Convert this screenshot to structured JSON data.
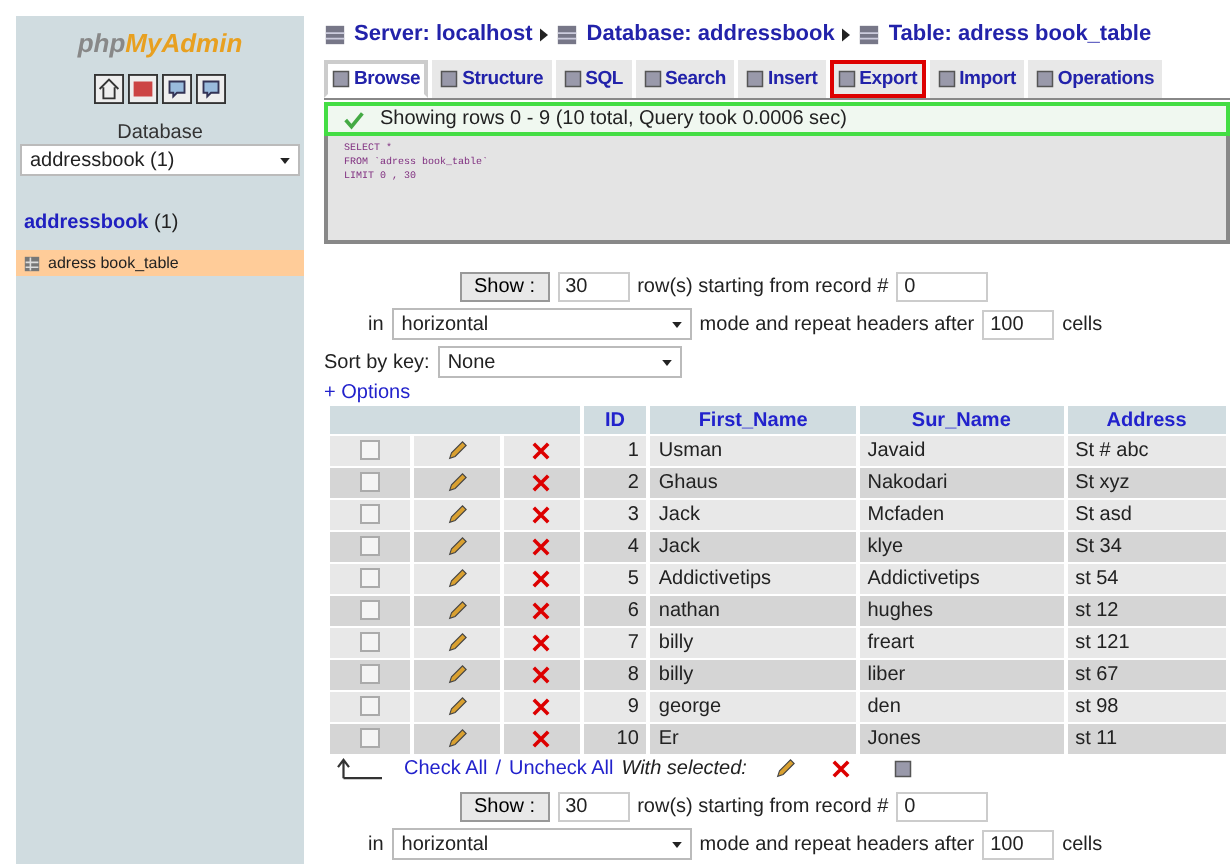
{
  "logo": {
    "part1": "php",
    "part2": "MyAdmin"
  },
  "sidebar": {
    "database_label": "Database",
    "database_select": "addressbook (1)",
    "db_link": {
      "name": "addressbook",
      "count": "(1)"
    },
    "tables": [
      {
        "name": "adress book_table",
        "selected": true
      }
    ]
  },
  "breadcrumb": [
    "Server: localhost",
    "Database: addressbook",
    "Table: adress book_table"
  ],
  "tabs": [
    {
      "label": "Browse",
      "selected": true,
      "highlighted": false
    },
    {
      "label": "Structure",
      "selected": false,
      "highlighted": false
    },
    {
      "label": "SQL",
      "selected": false,
      "highlighted": false
    },
    {
      "label": "Search",
      "selected": false,
      "highlighted": false
    },
    {
      "label": "Insert",
      "selected": false,
      "highlighted": false
    },
    {
      "label": "Export",
      "selected": false,
      "highlighted": true
    },
    {
      "label": "Import",
      "selected": false,
      "highlighted": false
    },
    {
      "label": "Operations",
      "selected": false,
      "highlighted": false
    }
  ],
  "message": "Showing rows 0 - 9 (10 total, Query took 0.0006 sec)",
  "sql": [
    "SELECT *",
    "FROM `adress book_table`",
    "LIMIT 0 , 30"
  ],
  "nav_top": {
    "button": "Show :",
    "rows": "30",
    "text1": "row(s) starting from record #",
    "start": "0",
    "in_label": "in",
    "mode": "horizontal",
    "text2": "mode and repeat headers after",
    "headers": "100",
    "text3": "cells"
  },
  "sort": {
    "label": "Sort by key:",
    "value": "None"
  },
  "options_link": "+ Options",
  "table": {
    "columns": [
      "ID",
      "First_Name",
      "Sur_Name",
      "Address"
    ],
    "rows": [
      {
        "checked": false,
        "cells": [
          "1",
          "Usman",
          "Javaid",
          "St # abc"
        ]
      },
      {
        "checked": false,
        "cells": [
          "2",
          "Ghaus",
          "Nakodari",
          "St xyz"
        ]
      },
      {
        "checked": false,
        "cells": [
          "3",
          "Jack",
          "Mcfaden",
          "St asd"
        ]
      },
      {
        "checked": false,
        "cells": [
          "4",
          "Jack",
          "klye",
          "St 34"
        ]
      },
      {
        "checked": false,
        "cells": [
          "5",
          "Addictivetips",
          "Addictivetips",
          "st 54"
        ]
      },
      {
        "checked": false,
        "cells": [
          "6",
          "nathan",
          "hughes",
          "st 12"
        ]
      },
      {
        "checked": false,
        "cells": [
          "7",
          "billy",
          "freart",
          "st 121"
        ]
      },
      {
        "checked": false,
        "cells": [
          "8",
          "billy",
          "liber",
          "st 67"
        ]
      },
      {
        "checked": false,
        "cells": [
          "9",
          "george",
          "den",
          "st 98"
        ]
      },
      {
        "checked": false,
        "cells": [
          "10",
          "Er",
          "Jones",
          "st 11"
        ]
      }
    ]
  },
  "footer": {
    "check_all": "Check All",
    "separator": "/",
    "uncheck_all": "Uncheck All",
    "with_selected": "With selected:"
  },
  "nav_bottom": {
    "button": "Show :",
    "rows": "30",
    "text1": "row(s) starting from record #",
    "start": "0",
    "in_label": "in",
    "mode": "horizontal",
    "text2": "mode and repeat headers after",
    "headers": "100",
    "text3": "cells"
  }
}
